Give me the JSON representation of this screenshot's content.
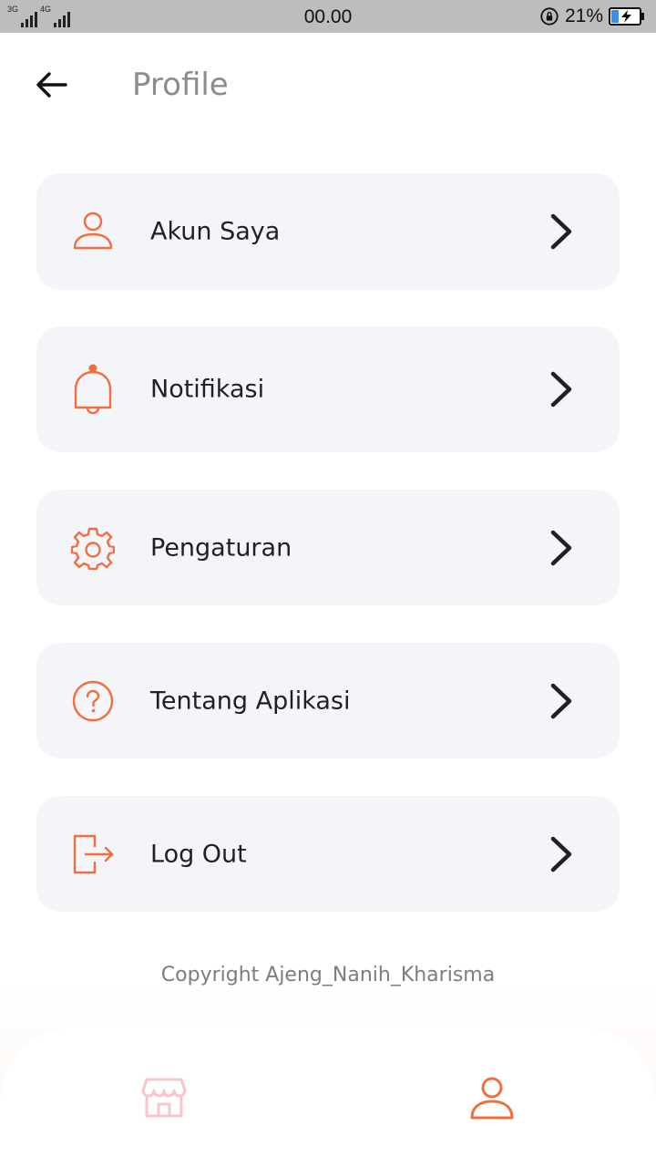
{
  "status_bar": {
    "net_left": "3G",
    "net_right": "4G",
    "time": "00.00",
    "battery": "21%"
  },
  "header": {
    "title": "Profile",
    "back_icon": "arrow-left-icon"
  },
  "menu": [
    {
      "label": "Akun Saya",
      "icon": "user-icon"
    },
    {
      "label": "Notifikasi",
      "icon": "bell-icon"
    },
    {
      "label": "Pengaturan",
      "icon": "gear-icon"
    },
    {
      "label": "Tentang Aplikasi",
      "icon": "help-circle-icon"
    },
    {
      "label": "Log Out",
      "icon": "logout-icon"
    }
  ],
  "footer": {
    "copyright": "Copyright Ajeng_Nanih_Kharisma"
  },
  "bottom_nav": {
    "items": [
      {
        "icon": "store-icon",
        "active": false
      },
      {
        "icon": "user-icon",
        "active": true
      }
    ]
  },
  "colors": {
    "accent": "#f36d3f",
    "accent_light": "#f7c6c9",
    "card_bg": "#f4f5f9",
    "text": "#1f1f24",
    "muted": "#8c8c8c",
    "status_bar": "#bdbdbd"
  }
}
